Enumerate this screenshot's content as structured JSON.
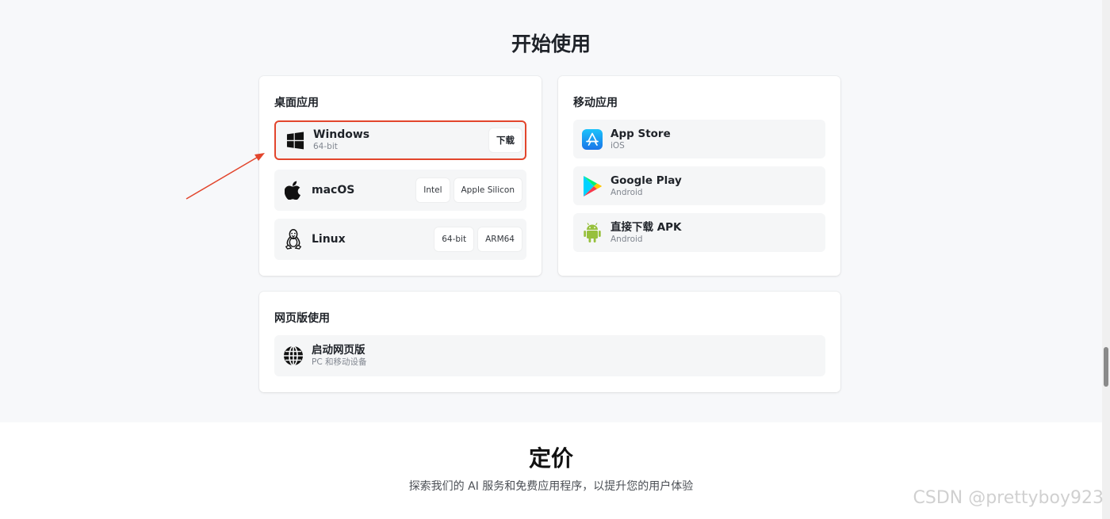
{
  "section_title": "开始使用",
  "desktop": {
    "title": "桌面应用",
    "windows": {
      "name": "Windows",
      "sub": "64-bit",
      "button": "下载"
    },
    "macos": {
      "name": "macOS",
      "buttons": [
        "Intel",
        "Apple Silicon"
      ]
    },
    "linux": {
      "name": "Linux",
      "buttons": [
        "64-bit",
        "ARM64"
      ]
    }
  },
  "mobile": {
    "title": "移动应用",
    "appstore": {
      "name": "App Store",
      "sub": "iOS"
    },
    "googleplay": {
      "name": "Google Play",
      "sub": "Android"
    },
    "apk": {
      "name": "直接下载 APK",
      "sub": "Android"
    }
  },
  "web": {
    "title": "网页版使用",
    "launch": {
      "name": "启动网页版",
      "sub": "PC 和移动设备"
    }
  },
  "pricing": {
    "title": "定价",
    "subtitle": "探索我们的 AI 服务和免费应用程序，以提升您的用户体验"
  },
  "watermark": "CSDN @prettyboy923",
  "colors": {
    "highlight": "#e2452c",
    "android_green": "#97c03d",
    "appstore_blue": "#1a8cf6"
  },
  "icons": {
    "windows": "windows-icon",
    "macos": "apple-icon",
    "linux": "linux-tux-icon",
    "appstore": "app-store-icon",
    "googleplay": "google-play-icon",
    "apk": "android-icon",
    "web": "globe-icon"
  }
}
